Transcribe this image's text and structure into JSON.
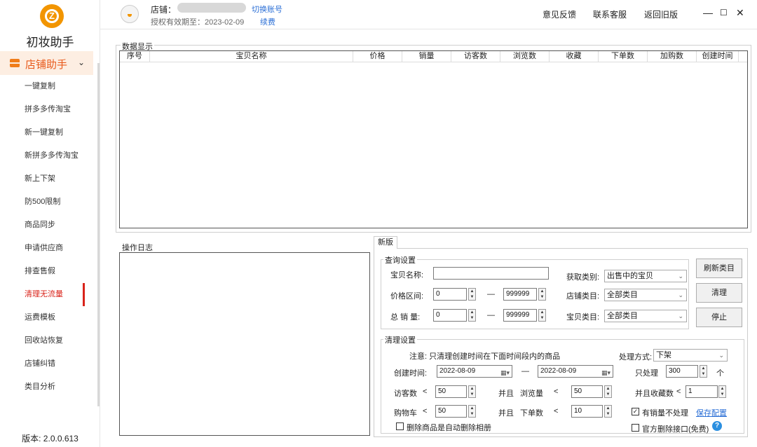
{
  "app": {
    "name": "初妆助手",
    "logo_letter": "Z",
    "version": "版本: 2.0.0.613"
  },
  "sidebar": {
    "group_label": "店铺助手",
    "items": [
      {
        "label": "一键复制"
      },
      {
        "label": "拼多多传淘宝"
      },
      {
        "label": "新一键复制"
      },
      {
        "label": "新拼多多传淘宝"
      },
      {
        "label": "新上下架"
      },
      {
        "label": "防500限制"
      },
      {
        "label": "商品同步"
      },
      {
        "label": "申请供应商"
      },
      {
        "label": "排查售假"
      },
      {
        "label": "清理无流量",
        "active": true
      },
      {
        "label": "运费模板"
      },
      {
        "label": "回收站恢复"
      },
      {
        "label": "店铺纠错"
      },
      {
        "label": "类目分析"
      }
    ]
  },
  "header": {
    "store_label": "店铺：",
    "switch_account": "切换账号",
    "auth_text": "授权有效期至：2023-02-09",
    "renew": "续费",
    "links": {
      "feedback": "意见反馈",
      "contact": "联系客服",
      "old_version": "返回旧版"
    }
  },
  "grid": {
    "title": "数据显示",
    "columns": [
      "序号",
      "宝贝名称",
      "价格",
      "销量",
      "访客数",
      "浏览数",
      "收藏",
      "下单数",
      "加购数",
      "创建时间"
    ]
  },
  "log": {
    "title": "操作日志"
  },
  "tab": {
    "label": "新版"
  },
  "query": {
    "title": "查询设置",
    "item_name_label": "宝贝名称:",
    "item_name_value": "",
    "price_label": "价格区间:",
    "price_min": "0",
    "price_max": "999999",
    "sales_label": "总 销 量:",
    "sales_min": "0",
    "sales_max": "999999",
    "dash": "—",
    "fetch_type_label": "获取类别:",
    "fetch_type_value": "出售中的宝贝",
    "shop_cat_label": "店铺类目:",
    "shop_cat_value": "全部类目",
    "item_cat_label": "宝贝类目:",
    "item_cat_value": "全部类目",
    "btn_refresh": "刷新类目",
    "btn_clean": "清理",
    "btn_stop": "停止"
  },
  "clean": {
    "title": "清理设置",
    "note": "注意: 只清理创建时间在下面时间段内的商品",
    "method_label": "处理方式:",
    "method_value": "下架",
    "created_label": "创建时间:",
    "date_from": "2022-08-09",
    "date_to": "2022-08-09",
    "only_label": "只处理",
    "only_value": "300",
    "only_unit": "个",
    "visitors_label": "访客数",
    "visitors_value": "50",
    "views_label": "浏览量",
    "views_value": "50",
    "fav_label": "并且收藏数",
    "fav_value": "1",
    "cart_label": "购物车",
    "cart_value": "50",
    "orders_label": "下单数",
    "orders_value": "10",
    "and_label": "并且",
    "lt": "<",
    "skip_sales_label": "有销量不处理",
    "skip_sales_checked": true,
    "save_config": "保存配置",
    "delete_album_label": "删除商品是自动删除相册",
    "delete_album_checked": false,
    "official_api_label": "官方删除接口(免费)",
    "official_api_checked": false
  }
}
